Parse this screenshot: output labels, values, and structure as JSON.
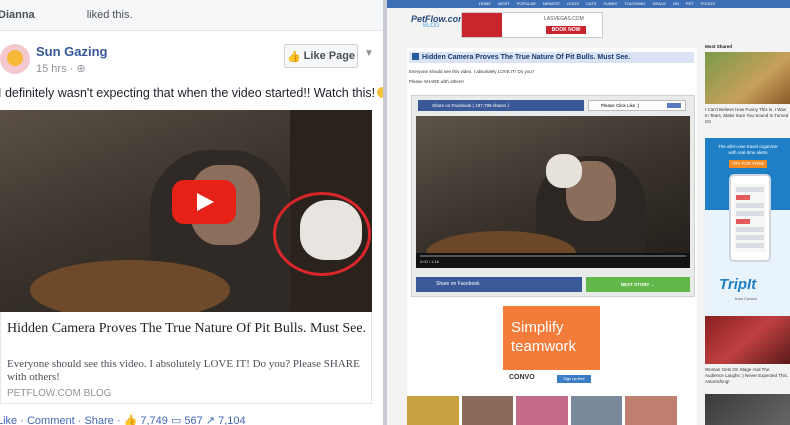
{
  "facebook": {
    "liked_bar": {
      "name": "Dianna",
      "text": "liked this."
    },
    "post": {
      "page_name": "Sun Gazing",
      "time": "15 hrs · ",
      "like_page_label": "Like Page",
      "text": "I definitely wasn't expecting that when the video started!! Watch this!",
      "link": {
        "title": "Hidden Camera Proves The True Nature Of Pit Bulls. Must See.",
        "description": "Everyone should see this video. I absolutely LOVE IT! Do you? Please SHARE with others!",
        "source": "PETFLOW.COM BLOG"
      },
      "actions": {
        "like": "Like",
        "comment": "Comment",
        "share": "Share",
        "likes_count": "7,749",
        "comments_count": "567",
        "shares_count": "7,104"
      }
    }
  },
  "site": {
    "nav_items": "HOME MOST POPULAR NEWEST DOGS CATS FUNNY TOUCHING DEALS ON PET FOODS",
    "logo": "PetFlow.com",
    "logo_sub": "BLOG",
    "top_ad": {
      "brand": "LASVEGAS.COM",
      "button": "BOOK NOW"
    },
    "article": {
      "title": "Hidden Camera Proves The True Nature Of Pit Bulls. Must See.",
      "line1": "Everyone should see this video. I absolutely LOVE IT! Do you?",
      "line2": "Please SHARE with others!",
      "share_bar_label": "Share on Facebook ( 197,799 shares )",
      "please_like_label": "Please Click Like :)",
      "video_time": "0:00 / 1:16",
      "share_button": "Share on Facebook",
      "next_button": "NEXT STORY →"
    },
    "convo_ad": {
      "headline": "Simplify teamwork",
      "brand": "CONVO",
      "button": "Sign up free"
    },
    "sidebar": {
      "heading": "Most Shared",
      "story1": "I Can't Believe How Funny This Is. I Was In Tears. Make Sure You Sound Is Turned On",
      "trip_text": "The all-in-one travel organizer with real-time alerts",
      "trip_button": "TRY FOR FREE",
      "trip_logo": "TripIt",
      "trip_sub": "from Concur",
      "story2": "Woman Gets On Stage And The Audience Laughs :) Never Expected This. Astonishing!"
    }
  },
  "colors": {
    "fb_blue": "#365899",
    "yt_red": "#e62117",
    "circle_red": "#d8262a",
    "fb_share": "#3b5998",
    "next_green": "#62b84b",
    "convo_orange": "#f37c3a"
  }
}
